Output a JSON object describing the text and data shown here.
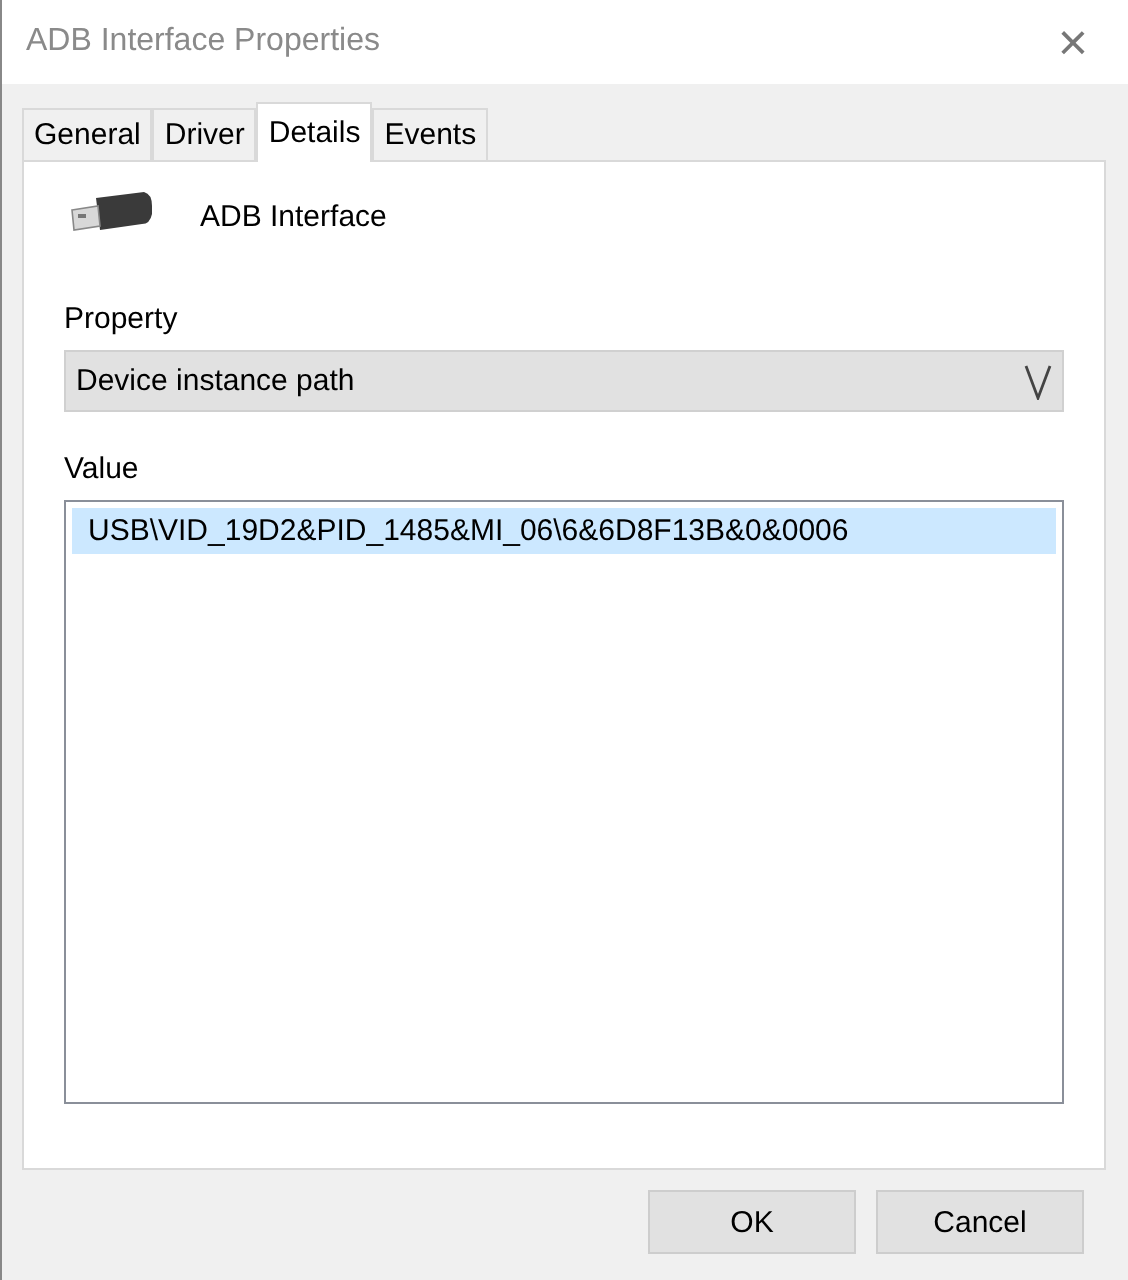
{
  "window": {
    "title": "ADB Interface Properties",
    "close": "×"
  },
  "tabs": [
    {
      "label": "General",
      "selected": false
    },
    {
      "label": "Driver",
      "selected": false
    },
    {
      "label": "Details",
      "selected": true
    },
    {
      "label": "Events",
      "selected": false
    }
  ],
  "device": {
    "name": "ADB Interface"
  },
  "property": {
    "label": "Property",
    "value": "Device instance path"
  },
  "value": {
    "label": "Value",
    "items": [
      {
        "text": "USB\\VID_19D2&PID_1485&MI_06\\6&6D8F13B&0&0006",
        "selected": true
      }
    ]
  },
  "buttons": [
    "OK",
    "Cancel"
  ]
}
